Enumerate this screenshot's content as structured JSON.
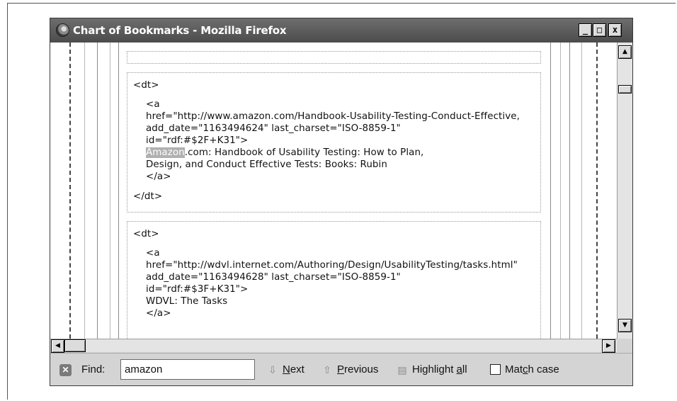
{
  "window": {
    "title": "Chart of Bookmarks - Mozilla Firefox"
  },
  "controls": {
    "minimize": "_",
    "maximize": "□",
    "close": "x"
  },
  "entries": [
    {
      "open_tag": "<dt>",
      "lines": [
        "<a",
        "href=\"http://www.amazon.com/Handbook-Usability-Testing-Conduct-Effective,",
        "add_date=\"1163494624\" last_charset=\"ISO-8859-1\"",
        "id=\"rdf:#$2F+K31\">",
        ".com: Handbook of Usability Testing: How to Plan,",
        "Design, and Conduct Effective Tests: Books: Rubin",
        "</a>"
      ],
      "match": "Amazon",
      "close_tag": "</dt>"
    },
    {
      "open_tag": "<dt>",
      "lines": [
        "<a",
        "href=\"http://wdvl.internet.com/Authoring/Design/UsabilityTesting/tasks.html\"",
        "add_date=\"1163494628\" last_charset=\"ISO-8859-1\"",
        "id=\"rdf:#$3F+K31\">",
        "WDVL: The Tasks",
        "</a>"
      ]
    }
  ],
  "findbar": {
    "label": "Find:",
    "value": "amazon",
    "next_prefix": "N",
    "next_rest": "ext",
    "previous_prefix": "P",
    "previous_rest": "revious",
    "highlight_prefix": "Highlight ",
    "highlight_key": "a",
    "highlight_rest": "ll",
    "matchcase_prefix": "Mat",
    "matchcase_key": "c",
    "matchcase_rest": "h case"
  },
  "icons": {
    "close": "close-icon",
    "next": "arrow-down-icon",
    "previous": "arrow-up-icon",
    "highlight": "highlighter-icon"
  }
}
